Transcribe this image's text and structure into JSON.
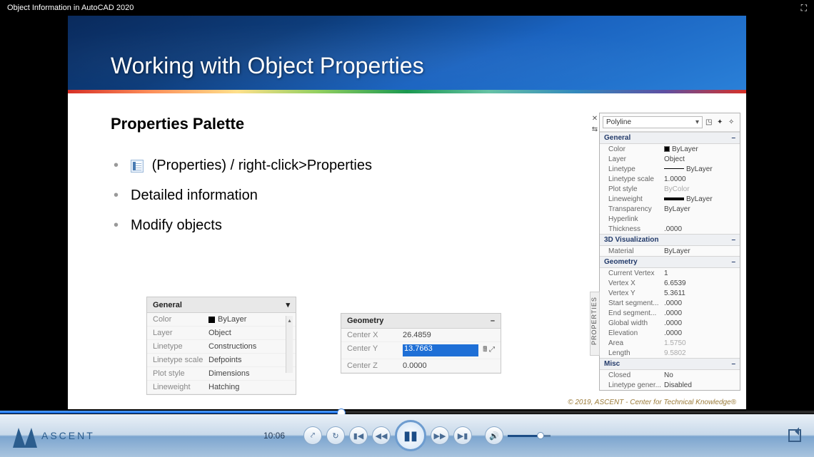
{
  "title": "Object Information in AutoCAD 2020",
  "slide": {
    "heading": "Working with Object Properties",
    "subheading": "Properties Palette",
    "bullets": [
      "(Properties) / right-click>Properties",
      "Detailed information",
      "Modify objects"
    ],
    "footer": "© 2019, ASCENT - Center for Technical Knowledge®"
  },
  "panel_general": {
    "title": "General",
    "rows": [
      {
        "k": "Color",
        "v": "ByLayer",
        "swatch": true
      },
      {
        "k": "Layer",
        "v": "Object"
      },
      {
        "k": "Linetype",
        "v": "Constructions"
      },
      {
        "k": "Linetype scale",
        "v": "Defpoints"
      },
      {
        "k": "Plot style",
        "v": "Dimensions"
      },
      {
        "k": "Lineweight",
        "v": "Hatching"
      }
    ]
  },
  "panel_geometry": {
    "title": "Geometry",
    "rows": [
      {
        "k": "Center X",
        "v": "26.4859"
      },
      {
        "k": "Center Y",
        "v": "13.7663",
        "selected": true
      },
      {
        "k": "Center Z",
        "v": "0.0000"
      }
    ]
  },
  "palette": {
    "sidebar_label": "PROPERTIES",
    "object_type": "Polyline",
    "sections": [
      {
        "name": "General",
        "rows": [
          {
            "k": "Color",
            "v": "ByLayer",
            "swatch": true
          },
          {
            "k": "Layer",
            "v": "Object"
          },
          {
            "k": "Linetype",
            "v": "ByLayer",
            "line": true
          },
          {
            "k": "Linetype scale",
            "v": "1.0000"
          },
          {
            "k": "Plot style",
            "v": "ByColor",
            "dim": true
          },
          {
            "k": "Lineweight",
            "v": "ByLayer",
            "thick": true
          },
          {
            "k": "Transparency",
            "v": "ByLayer"
          },
          {
            "k": "Hyperlink",
            "v": ""
          },
          {
            "k": "Thickness",
            "v": ".0000"
          }
        ]
      },
      {
        "name": "3D Visualization",
        "rows": [
          {
            "k": "Material",
            "v": "ByLayer"
          }
        ]
      },
      {
        "name": "Geometry",
        "rows": [
          {
            "k": "Current Vertex",
            "v": "1"
          },
          {
            "k": "Vertex X",
            "v": "6.6539"
          },
          {
            "k": "Vertex Y",
            "v": "5.3611"
          },
          {
            "k": "Start segment...",
            "v": ".0000"
          },
          {
            "k": "End segment...",
            "v": ".0000"
          },
          {
            "k": "Global width",
            "v": ".0000"
          },
          {
            "k": "Elevation",
            "v": ".0000"
          },
          {
            "k": "Area",
            "v": "1.5750",
            "dim": true
          },
          {
            "k": "Length",
            "v": "9.5802",
            "dim": true
          }
        ]
      },
      {
        "name": "Misc",
        "rows": [
          {
            "k": "Closed",
            "v": "No"
          },
          {
            "k": "Linetype gener...",
            "v": "Disabled"
          }
        ]
      }
    ]
  },
  "player": {
    "time": "10:06",
    "logo_text": "ASCENT"
  }
}
